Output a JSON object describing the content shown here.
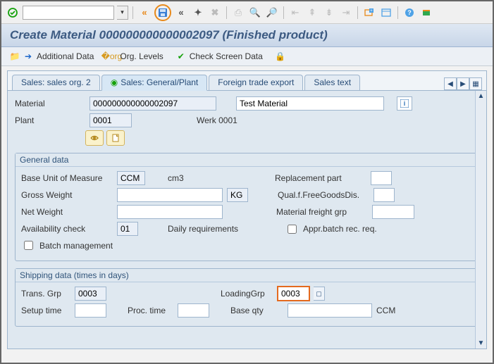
{
  "toolbar": {
    "command_value": "",
    "command_placeholder": ""
  },
  "title": "Create Material 000000000000002097 (Finished product)",
  "subtoolbar": {
    "additional_data": "Additional Data",
    "org_levels": "Org. Levels",
    "check_screen": "Check Screen Data"
  },
  "tabs": {
    "t0": "Sales: sales org. 2",
    "t1": "Sales: General/Plant",
    "t2": "Foreign trade export",
    "t3": "Sales text"
  },
  "header": {
    "material_lbl": "Material",
    "material_val": "000000000000002097",
    "material_desc": "Test Material",
    "plant_lbl": "Plant",
    "plant_val": "0001",
    "plant_desc": "Werk 0001"
  },
  "general": {
    "legend": "General data",
    "buom_lbl": "Base Unit of Measure",
    "buom_val": "CCM",
    "buom_desc": "cm3",
    "replacement_lbl": "Replacement part",
    "replacement_val": "",
    "gross_lbl": "Gross Weight",
    "gross_val": "",
    "gross_unit": "KG",
    "qualf_lbl": "Qual.f.FreeGoodsDis.",
    "qualf_val": "",
    "net_lbl": "Net Weight",
    "net_val": "",
    "freight_lbl": "Material freight grp",
    "freight_val": "",
    "avail_lbl": "Availability check",
    "avail_val": "01",
    "avail_desc": "Daily requirements",
    "appr_lbl": "Appr.batch rec. req.",
    "batch_lbl": "Batch management"
  },
  "shipping": {
    "legend": "Shipping data (times in days)",
    "trans_lbl": "Trans. Grp",
    "trans_val": "0003",
    "loading_lbl": "LoadingGrp",
    "loading_val": "0003",
    "setup_lbl": "Setup time",
    "setup_val": "",
    "proc_lbl": "Proc. time",
    "proc_val": "",
    "base_lbl": "Base qty",
    "base_val": "",
    "base_unit": "CCM"
  }
}
